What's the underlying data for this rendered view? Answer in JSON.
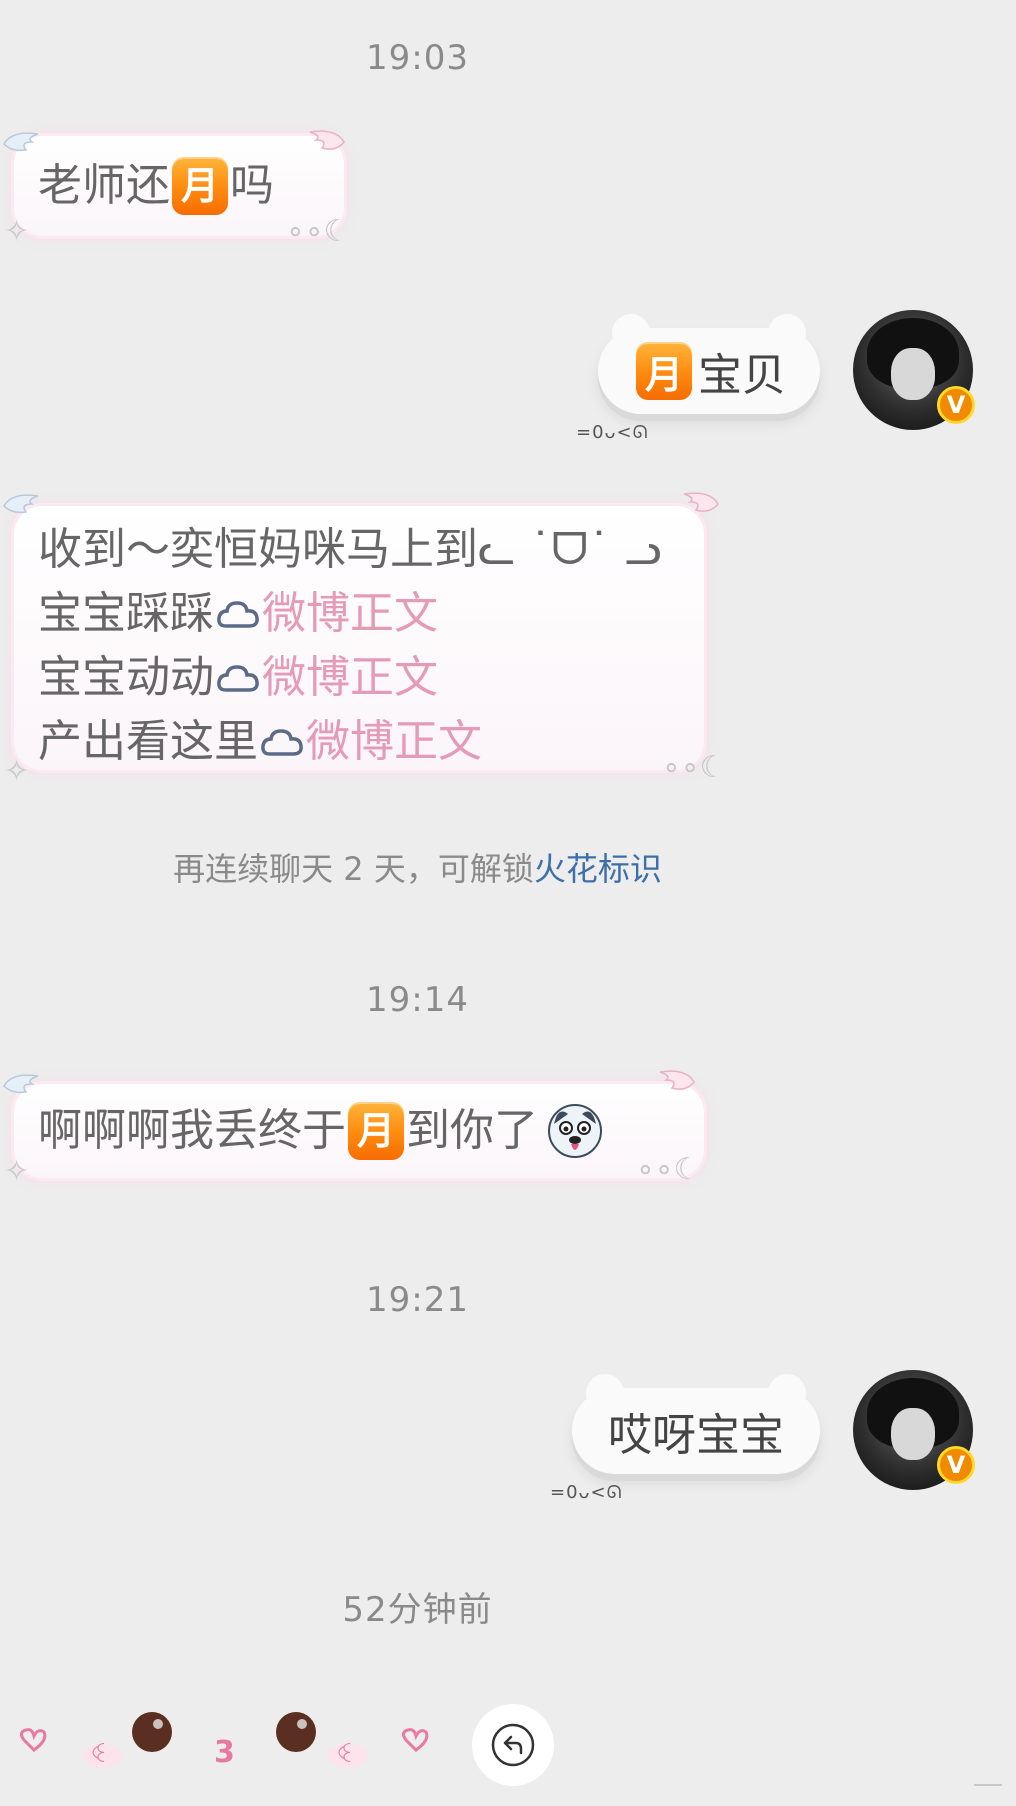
{
  "messages": {
    "ts1": "19:03",
    "m1": {
      "pre": "老师还",
      "chip": "月",
      "post": "吗"
    },
    "m2": {
      "chip": "月",
      "text": "宝贝",
      "read": "=0ᴗ<ᘏ"
    },
    "m3": {
      "line1": "收到～奕恒妈咪马上到ᓚ ˙ᗜ˙ ᓗ",
      "line2_pre": "宝宝踩踩",
      "line2_link": "微博正文",
      "line3_pre": "宝宝动动",
      "line3_link": "微博正文",
      "line4_pre": "产出看这里",
      "line4_link": "微博正文"
    },
    "system": {
      "pre": "再连续聊天 2 天，可解锁",
      "highlight": "火花标识"
    },
    "ts2": "19:14",
    "m4": {
      "pre": "啊啊啊我丢终于",
      "chip": "月",
      "post": "到你了",
      "emoji": "dog-face-emoji"
    },
    "ts3": "19:21",
    "m5": {
      "text": "哎呀宝宝",
      "read": "=0ᴗ<ᘏ"
    },
    "ts4": "52分钟前"
  },
  "bottom": {
    "kaomoji": [
      "ꒊ",
      "·",
      "3",
      "·",
      "ꒊ"
    ],
    "reply_icon": "reply-arrow-icon"
  },
  "colors": {
    "background": "#ededed",
    "chip_orange": "#ff8a0e",
    "link_pink": "#e59bb8",
    "system_blue": "#3d6fa8",
    "verified_badge": "#f28a00"
  }
}
